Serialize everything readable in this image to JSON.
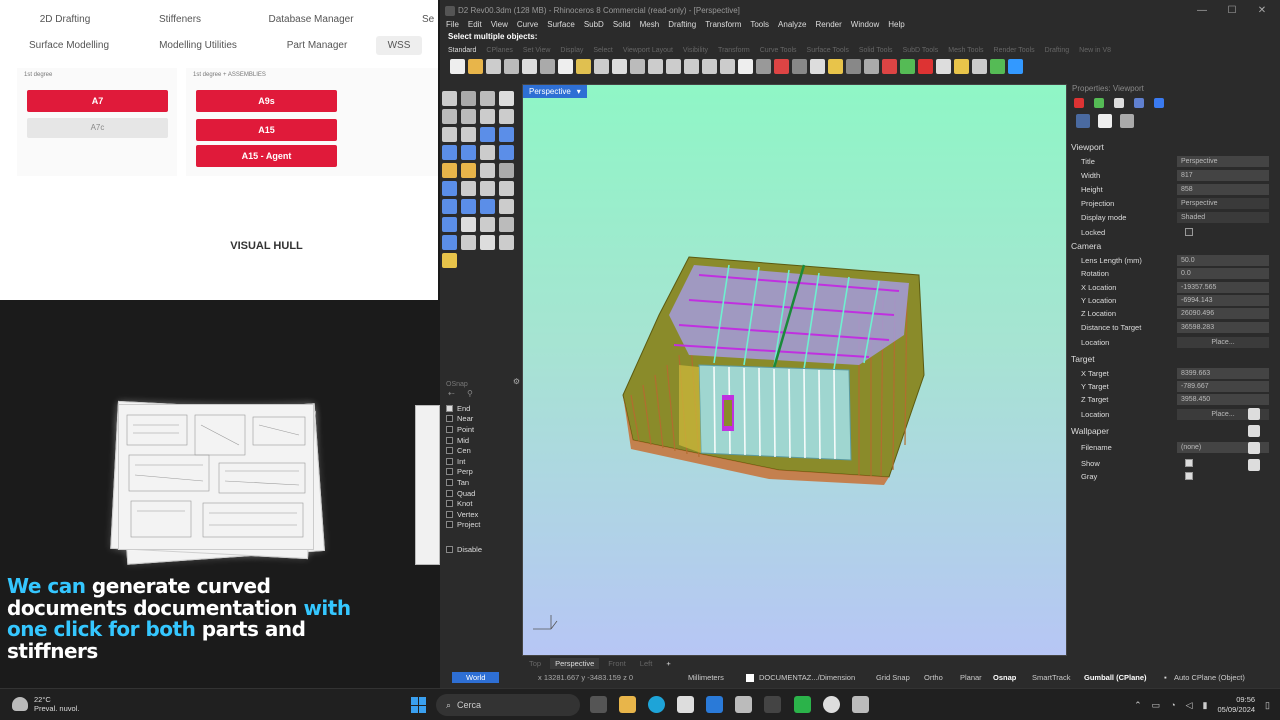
{
  "left_app": {
    "tabs_row1": [
      "2D Drafting",
      "Stiffeners",
      "Database Manager",
      "Se"
    ],
    "tabs_row2": [
      "Surface Modelling",
      "Modelling Utilities",
      "Part Manager",
      "WSS"
    ],
    "group1_label": "1st degree",
    "group2_label": "1st degree + ASSEMBLIES",
    "buttons": {
      "a7": "A7",
      "a7c": "A7c",
      "a9s": "A9s",
      "a15": "A15",
      "a15_agent": "A15 - Agent"
    },
    "visual_hull": "VISUAL HULL"
  },
  "caption": {
    "hl1": "We can",
    "p1": " generate curved documents documentation ",
    "hl2": "with one click for both",
    "p2": " parts and stiffners"
  },
  "rhino": {
    "title": "D2 Rev00.3dm (128 MB) - Rhinoceros 8 Commercial (read-only) - [Perspective]",
    "menu": [
      "File",
      "Edit",
      "View",
      "Curve",
      "Surface",
      "SubD",
      "Solid",
      "Mesh",
      "Drafting",
      "Transform",
      "Tools",
      "Analyze",
      "Render",
      "Window",
      "Help"
    ],
    "command_prompt": "Select multiple objects:",
    "toolbar_tabs": [
      "Standard",
      "CPlanes",
      "Set View",
      "Display",
      "Select",
      "Viewport Layout",
      "Visibility",
      "Transform",
      "Curve Tools",
      "Surface Tools",
      "Solid Tools",
      "SubD Tools",
      "Mesh Tools",
      "Render Tools",
      "Drafting",
      "New in V8"
    ],
    "osnap": {
      "title": "OSnap",
      "items": [
        {
          "label": "End",
          "checked": true
        },
        {
          "label": "Near",
          "checked": false
        },
        {
          "label": "Point",
          "checked": false
        },
        {
          "label": "Mid",
          "checked": false
        },
        {
          "label": "Cen",
          "checked": false
        },
        {
          "label": "Int",
          "checked": false
        },
        {
          "label": "Perp",
          "checked": false
        },
        {
          "label": "Tan",
          "checked": false
        },
        {
          "label": "Quad",
          "checked": false
        },
        {
          "label": "Knot",
          "checked": false
        },
        {
          "label": "Vertex",
          "checked": false
        },
        {
          "label": "Project",
          "checked": false
        }
      ],
      "disable": "Disable"
    },
    "viewport_label": "Perspective",
    "viewport_tabs": [
      "Top",
      "Perspective",
      "Front",
      "Left"
    ],
    "status": {
      "world": "World",
      "coords": "x 13281.667  y -3483.159  z 0",
      "units": "Millimeters",
      "layer": "DOCUMENTAZ.../Dimension",
      "grid_snap": "Grid Snap",
      "ortho": "Ortho",
      "planar": "Planar",
      "osnap": "Osnap",
      "smarttrack": "SmartTrack",
      "gumball": "Gumball (CPlane)",
      "auto_cplane": "Auto CPlane (Object)"
    },
    "properties": {
      "title": "Properties: Viewport",
      "viewport_head": "Viewport",
      "title_lbl": "Title",
      "title_val": "Perspective",
      "width_lbl": "Width",
      "width_val": "817",
      "height_lbl": "Height",
      "height_val": "858",
      "projection_lbl": "Projection",
      "projection_val": "Perspective",
      "display_lbl": "Display mode",
      "display_val": "Shaded",
      "locked_lbl": "Locked",
      "camera_head": "Camera",
      "lens_lbl": "Lens Length (mm)",
      "lens_val": "50.0",
      "rotation_lbl": "Rotation",
      "rotation_val": "0.0",
      "xloc_lbl": "X Location",
      "xloc_val": "-19357.565",
      "yloc_lbl": "Y Location",
      "yloc_val": "-6994.143",
      "zloc_lbl": "Z Location",
      "zloc_val": "26090.496",
      "dist_lbl": "Distance to Target",
      "dist_val": "36598.283",
      "location_lbl": "Location",
      "place_btn": "Place...",
      "target_head": "Target",
      "xt_lbl": "X Target",
      "xt_val": "8399.663",
      "yt_lbl": "Y Target",
      "yt_val": "-789.667",
      "zt_lbl": "Z Target",
      "zt_val": "3958.450",
      "tloc_lbl": "Location",
      "tplace_btn": "Place...",
      "wallpaper_head": "Wallpaper",
      "filename_lbl": "Filename",
      "filename_val": "(none)",
      "show_lbl": "Show",
      "gray_lbl": "Gray"
    }
  },
  "taskbar": {
    "weather_temp": "22°C",
    "weather_desc": "Preval. nuvol.",
    "search": "Cerca",
    "time": "09:56",
    "date": "05/09/2024"
  },
  "colors": {
    "accent_red": "#e01a3a",
    "caption_highlight": "#35c7ff",
    "rhino_blue": "#2e6fd4"
  }
}
